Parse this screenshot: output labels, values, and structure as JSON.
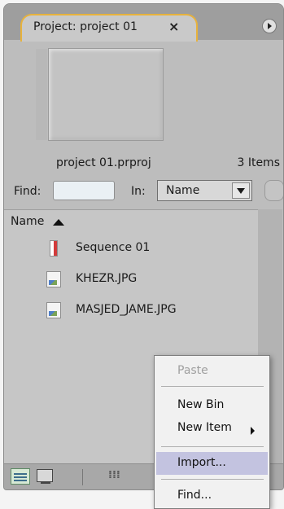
{
  "tab": {
    "title": "Project: project 01",
    "close_symbol": "×"
  },
  "project": {
    "file_name": "project 01.prproj",
    "item_count": "3 Items"
  },
  "search": {
    "find_label": "Find:",
    "find_value": "",
    "in_label": "In:",
    "in_value": "Name"
  },
  "list": {
    "column_header": "Name",
    "items": [
      {
        "label": "Sequence 01",
        "icon": "sequence-icon"
      },
      {
        "label": "KHEZR.JPG",
        "icon": "image-file-icon"
      },
      {
        "label": "MASJED_JAME.JPG",
        "icon": "image-file-icon"
      }
    ]
  },
  "context_menu": {
    "items": [
      {
        "label": "Paste",
        "enabled": false
      },
      {
        "label": "New Bin",
        "enabled": true
      },
      {
        "label": "New Item",
        "enabled": true,
        "has_submenu": true
      },
      {
        "label": "Import...",
        "enabled": true,
        "highlighted": true
      },
      {
        "label": "Find...",
        "enabled": true
      }
    ]
  },
  "colors": {
    "tab_outline": "#e7b23c",
    "menu_highlight": "#c3c3e0"
  }
}
